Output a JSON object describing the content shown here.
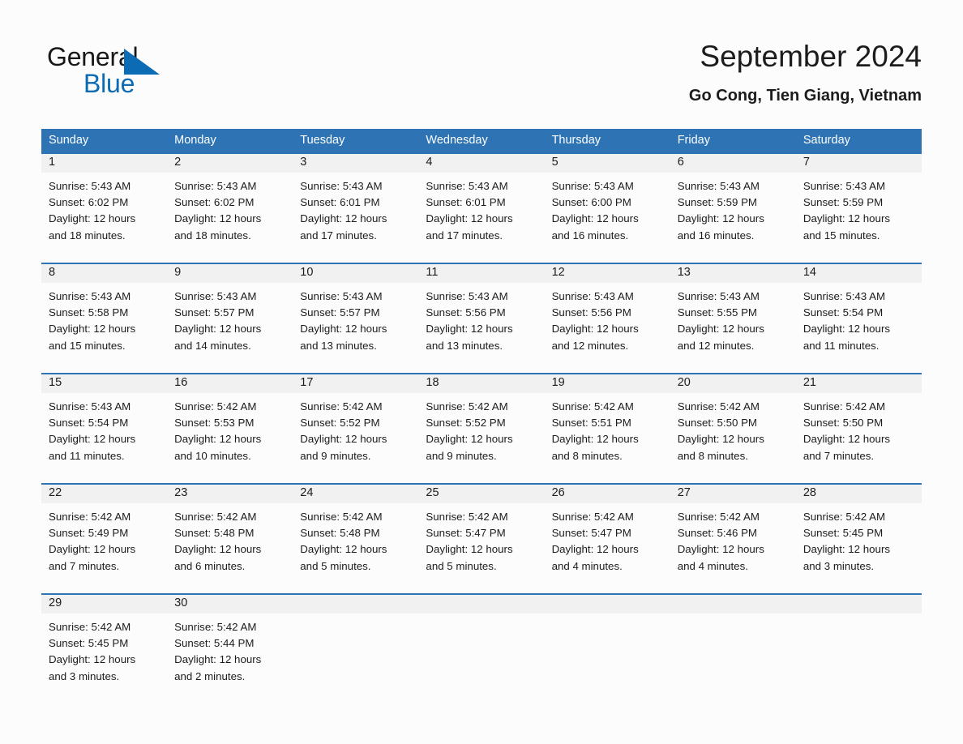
{
  "brand": {
    "name_line1": "General",
    "name_line2": "Blue",
    "triangle_icon": "blue-triangle",
    "color_text": "#17181a",
    "color_blue": "#0b6bb5"
  },
  "header": {
    "title": "September 2024",
    "subtitle": "Go Cong, Tien Giang, Vietnam"
  },
  "theme": {
    "header_blue": "#2e74b5",
    "day_band_gray": "#f1f1f1",
    "page_background": "#fcfcfc",
    "text": "#1b1c1e"
  },
  "calendar": {
    "day_headers": [
      "Sunday",
      "Monday",
      "Tuesday",
      "Wednesday",
      "Thursday",
      "Friday",
      "Saturday"
    ],
    "weeks": [
      {
        "numbers": [
          "1",
          "2",
          "3",
          "4",
          "5",
          "6",
          "7"
        ],
        "days": [
          {
            "sunrise": "Sunrise: 5:43 AM",
            "sunset": "Sunset: 6:02 PM",
            "daylight_1": "Daylight: 12 hours",
            "daylight_2": "and 18 minutes."
          },
          {
            "sunrise": "Sunrise: 5:43 AM",
            "sunset": "Sunset: 6:02 PM",
            "daylight_1": "Daylight: 12 hours",
            "daylight_2": "and 18 minutes."
          },
          {
            "sunrise": "Sunrise: 5:43 AM",
            "sunset": "Sunset: 6:01 PM",
            "daylight_1": "Daylight: 12 hours",
            "daylight_2": "and 17 minutes."
          },
          {
            "sunrise": "Sunrise: 5:43 AM",
            "sunset": "Sunset: 6:01 PM",
            "daylight_1": "Daylight: 12 hours",
            "daylight_2": "and 17 minutes."
          },
          {
            "sunrise": "Sunrise: 5:43 AM",
            "sunset": "Sunset: 6:00 PM",
            "daylight_1": "Daylight: 12 hours",
            "daylight_2": "and 16 minutes."
          },
          {
            "sunrise": "Sunrise: 5:43 AM",
            "sunset": "Sunset: 5:59 PM",
            "daylight_1": "Daylight: 12 hours",
            "daylight_2": "and 16 minutes."
          },
          {
            "sunrise": "Sunrise: 5:43 AM",
            "sunset": "Sunset: 5:59 PM",
            "daylight_1": "Daylight: 12 hours",
            "daylight_2": "and 15 minutes."
          }
        ]
      },
      {
        "numbers": [
          "8",
          "9",
          "10",
          "11",
          "12",
          "13",
          "14"
        ],
        "days": [
          {
            "sunrise": "Sunrise: 5:43 AM",
            "sunset": "Sunset: 5:58 PM",
            "daylight_1": "Daylight: 12 hours",
            "daylight_2": "and 15 minutes."
          },
          {
            "sunrise": "Sunrise: 5:43 AM",
            "sunset": "Sunset: 5:57 PM",
            "daylight_1": "Daylight: 12 hours",
            "daylight_2": "and 14 minutes."
          },
          {
            "sunrise": "Sunrise: 5:43 AM",
            "sunset": "Sunset: 5:57 PM",
            "daylight_1": "Daylight: 12 hours",
            "daylight_2": "and 13 minutes."
          },
          {
            "sunrise": "Sunrise: 5:43 AM",
            "sunset": "Sunset: 5:56 PM",
            "daylight_1": "Daylight: 12 hours",
            "daylight_2": "and 13 minutes."
          },
          {
            "sunrise": "Sunrise: 5:43 AM",
            "sunset": "Sunset: 5:56 PM",
            "daylight_1": "Daylight: 12 hours",
            "daylight_2": "and 12 minutes."
          },
          {
            "sunrise": "Sunrise: 5:43 AM",
            "sunset": "Sunset: 5:55 PM",
            "daylight_1": "Daylight: 12 hours",
            "daylight_2": "and 12 minutes."
          },
          {
            "sunrise": "Sunrise: 5:43 AM",
            "sunset": "Sunset: 5:54 PM",
            "daylight_1": "Daylight: 12 hours",
            "daylight_2": "and 11 minutes."
          }
        ]
      },
      {
        "numbers": [
          "15",
          "16",
          "17",
          "18",
          "19",
          "20",
          "21"
        ],
        "days": [
          {
            "sunrise": "Sunrise: 5:43 AM",
            "sunset": "Sunset: 5:54 PM",
            "daylight_1": "Daylight: 12 hours",
            "daylight_2": "and 11 minutes."
          },
          {
            "sunrise": "Sunrise: 5:42 AM",
            "sunset": "Sunset: 5:53 PM",
            "daylight_1": "Daylight: 12 hours",
            "daylight_2": "and 10 minutes."
          },
          {
            "sunrise": "Sunrise: 5:42 AM",
            "sunset": "Sunset: 5:52 PM",
            "daylight_1": "Daylight: 12 hours",
            "daylight_2": "and 9 minutes."
          },
          {
            "sunrise": "Sunrise: 5:42 AM",
            "sunset": "Sunset: 5:52 PM",
            "daylight_1": "Daylight: 12 hours",
            "daylight_2": "and 9 minutes."
          },
          {
            "sunrise": "Sunrise: 5:42 AM",
            "sunset": "Sunset: 5:51 PM",
            "daylight_1": "Daylight: 12 hours",
            "daylight_2": "and 8 minutes."
          },
          {
            "sunrise": "Sunrise: 5:42 AM",
            "sunset": "Sunset: 5:50 PM",
            "daylight_1": "Daylight: 12 hours",
            "daylight_2": "and 8 minutes."
          },
          {
            "sunrise": "Sunrise: 5:42 AM",
            "sunset": "Sunset: 5:50 PM",
            "daylight_1": "Daylight: 12 hours",
            "daylight_2": "and 7 minutes."
          }
        ]
      },
      {
        "numbers": [
          "22",
          "23",
          "24",
          "25",
          "26",
          "27",
          "28"
        ],
        "days": [
          {
            "sunrise": "Sunrise: 5:42 AM",
            "sunset": "Sunset: 5:49 PM",
            "daylight_1": "Daylight: 12 hours",
            "daylight_2": "and 7 minutes."
          },
          {
            "sunrise": "Sunrise: 5:42 AM",
            "sunset": "Sunset: 5:48 PM",
            "daylight_1": "Daylight: 12 hours",
            "daylight_2": "and 6 minutes."
          },
          {
            "sunrise": "Sunrise: 5:42 AM",
            "sunset": "Sunset: 5:48 PM",
            "daylight_1": "Daylight: 12 hours",
            "daylight_2": "and 5 minutes."
          },
          {
            "sunrise": "Sunrise: 5:42 AM",
            "sunset": "Sunset: 5:47 PM",
            "daylight_1": "Daylight: 12 hours",
            "daylight_2": "and 5 minutes."
          },
          {
            "sunrise": "Sunrise: 5:42 AM",
            "sunset": "Sunset: 5:47 PM",
            "daylight_1": "Daylight: 12 hours",
            "daylight_2": "and 4 minutes."
          },
          {
            "sunrise": "Sunrise: 5:42 AM",
            "sunset": "Sunset: 5:46 PM",
            "daylight_1": "Daylight: 12 hours",
            "daylight_2": "and 4 minutes."
          },
          {
            "sunrise": "Sunrise: 5:42 AM",
            "sunset": "Sunset: 5:45 PM",
            "daylight_1": "Daylight: 12 hours",
            "daylight_2": "and 3 minutes."
          }
        ]
      },
      {
        "numbers": [
          "29",
          "30",
          "",
          "",
          "",
          "",
          ""
        ],
        "days": [
          {
            "sunrise": "Sunrise: 5:42 AM",
            "sunset": "Sunset: 5:45 PM",
            "daylight_1": "Daylight: 12 hours",
            "daylight_2": "and 3 minutes."
          },
          {
            "sunrise": "Sunrise: 5:42 AM",
            "sunset": "Sunset: 5:44 PM",
            "daylight_1": "Daylight: 12 hours",
            "daylight_2": "and 2 minutes."
          },
          {
            "sunrise": "",
            "sunset": "",
            "daylight_1": "",
            "daylight_2": ""
          },
          {
            "sunrise": "",
            "sunset": "",
            "daylight_1": "",
            "daylight_2": ""
          },
          {
            "sunrise": "",
            "sunset": "",
            "daylight_1": "",
            "daylight_2": ""
          },
          {
            "sunrise": "",
            "sunset": "",
            "daylight_1": "",
            "daylight_2": ""
          },
          {
            "sunrise": "",
            "sunset": "",
            "daylight_1": "",
            "daylight_2": ""
          }
        ]
      }
    ]
  }
}
